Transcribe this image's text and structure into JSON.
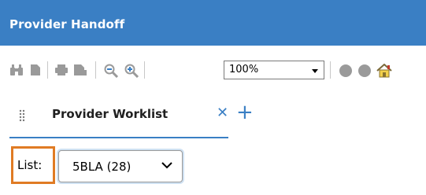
{
  "window": {
    "title": "Provider Handoff"
  },
  "toolbar": {
    "icons": [
      "binoculars-icon",
      "document-icon",
      "print-icon",
      "print-preview-icon",
      "zoom-out-icon",
      "zoom-in-icon",
      "circle-icon",
      "circle-icon",
      "home-icon"
    ],
    "zoom_value": "100%"
  },
  "tabs": [
    {
      "label": "Provider Worklist",
      "active": true
    }
  ],
  "list": {
    "label": "List:",
    "selected": "5BLA (28)"
  },
  "colors": {
    "accent": "#3a7fc4",
    "highlight_border": "#e07b24",
    "icon_gray": "#9a9a9a"
  }
}
